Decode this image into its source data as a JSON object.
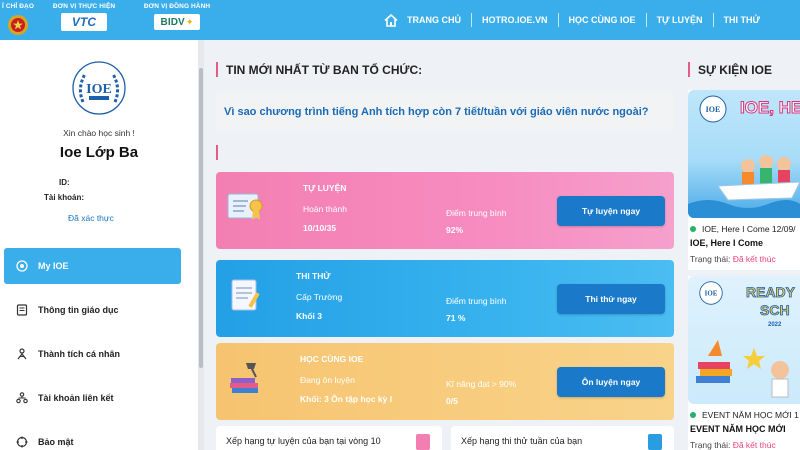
{
  "header": {
    "sponsors": [
      "Ỉ CHỈ ĐẠO",
      "ĐƠN VỊ THỰC HIỆN",
      "ĐƠN VỊ ĐỒNG HÀNH"
    ],
    "vtc_logo": "VTC",
    "bidv_logo": "BIDV",
    "nav": [
      "TRANG CHỦ",
      "HOTRO.IOE.VN",
      "HỌC CÙNG IOE",
      "TỰ LUYỆN",
      "THI THỬ"
    ]
  },
  "profile": {
    "logo_text": "IOE",
    "greeting": "Xin chào học sinh !",
    "name": "Ioe Lớp Ba",
    "id_label": "ID:",
    "account_label": "Tài khoản:",
    "verified": "Đã xác thực"
  },
  "menu": [
    {
      "label": "My IOE",
      "icon": "home-icon",
      "active": true
    },
    {
      "label": "Thông tin giáo dục",
      "icon": "document-icon",
      "active": false
    },
    {
      "label": "Thành tích cá nhân",
      "icon": "achievement-icon",
      "active": false
    },
    {
      "label": "Tài khoản liên kết",
      "icon": "link-accounts-icon",
      "active": false
    },
    {
      "label": "Bảo mật",
      "icon": "security-icon",
      "active": false
    }
  ],
  "news": {
    "title": "TIN MỚI NHẤT TỪ BAN TỔ CHỨC:",
    "headline": "Vì sao chương trình tiếng Anh tích hợp còn 7 tiết/tuần với giáo viên nước ngoài?"
  },
  "cards": [
    {
      "title": "TỰ LUYỆN",
      "label1": "Hoàn thành",
      "value1": "10/10/35",
      "label2": "Điểm trung bình",
      "value2": "92%",
      "button": "Tự luyện ngay"
    },
    {
      "title": "THI THỬ",
      "label1": "Cấp Trường",
      "value1": "Khối 3",
      "label2": "Điểm trung bình",
      "value2": "71 %",
      "button": "Thi thử ngay"
    },
    {
      "title": "HỌC CÙNG IOE",
      "label1": "Đang ôn luyện",
      "value1": "Khối: 3 Ôn tập học kỳ I",
      "label2": "Kĩ năng đạt > 90%",
      "value2": "0/5",
      "button": "Ôn luyện ngay"
    }
  ],
  "bottom": [
    {
      "label": "Xếp hạng tự luyện của bạn tại vòng 10"
    },
    {
      "label": "Xếp hạng thi thử tuần của bạn"
    }
  ],
  "events": {
    "title": "SỰ KIỆN IOE",
    "items": [
      {
        "banner": "IOE, HE",
        "line1": "IOE, Here I Come 12/09/",
        "line2": "IOE, Here I Come",
        "status_label": "Trạng thái:",
        "status": "Đã kết thúc"
      },
      {
        "banner": "READY",
        "banner2": "SCH",
        "year": "2022",
        "line1": "EVENT NĂM HỌC MỚI 1",
        "line2": "EVENT NĂM HỌC MỚI",
        "status_label": "Trạng thái:",
        "status": "Đã kết thúc"
      }
    ]
  },
  "colors": {
    "header": "#3aaeea",
    "active_menu": "#3aaeea",
    "card_pink": "#f37fb2",
    "card_blue": "#23a0e6",
    "card_orange": "#f6c470",
    "button": "#1a79c9",
    "accent": "#e85a86",
    "link": "#1a6ab5"
  }
}
